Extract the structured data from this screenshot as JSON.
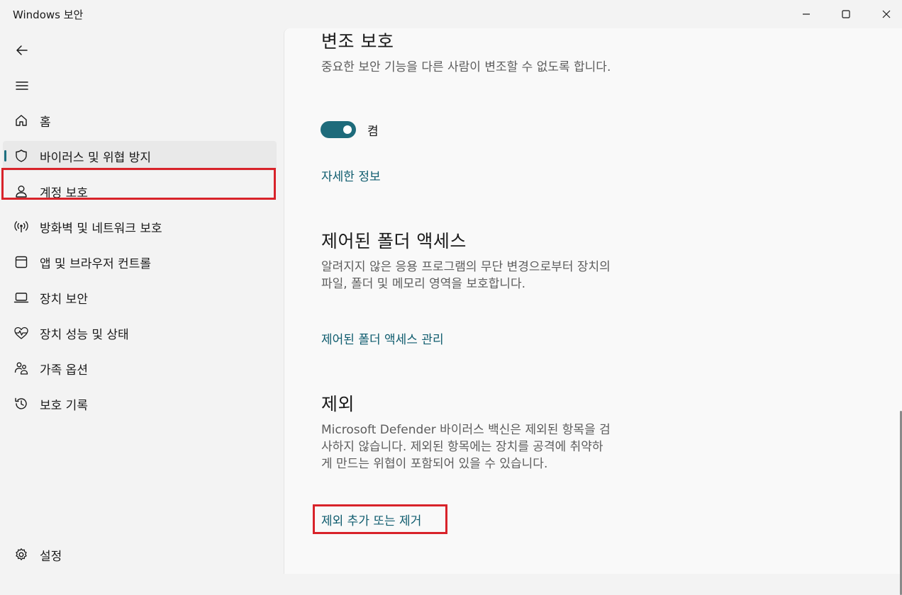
{
  "window": {
    "title": "Windows 보안"
  },
  "sidebar": {
    "items": [
      {
        "label": "홈",
        "icon": "home-icon"
      },
      {
        "label": "바이러스 및 위협 방지",
        "icon": "shield-icon"
      },
      {
        "label": "계정 보호",
        "icon": "person-icon"
      },
      {
        "label": "방화벽 및 네트워크 보호",
        "icon": "antenna-icon"
      },
      {
        "label": "앱 및 브라우저 컨트롤",
        "icon": "app-window-icon"
      },
      {
        "label": "장치 보안",
        "icon": "laptop-icon"
      },
      {
        "label": "장치 성능 및 상태",
        "icon": "heart-pulse-icon"
      },
      {
        "label": "가족 옵션",
        "icon": "family-icon"
      },
      {
        "label": "보호 기록",
        "icon": "history-icon"
      }
    ],
    "settings_label": "설정"
  },
  "content": {
    "tamper": {
      "title": "변조 보호",
      "desc": "중요한 보안 기능을 다른 사람이 변조할 수 없도록 합니다.",
      "toggle_state": "켬",
      "toggle_on": true,
      "link": "자세한 정보"
    },
    "cfa": {
      "title": "제어된 폴더 액세스",
      "desc": "알려지지 않은 응용 프로그램의 무단 변경으로부터 장치의 파일, 폴더 및 메모리 영역을 보호합니다.",
      "link": "제어된 폴더 액세스 관리"
    },
    "exclusions": {
      "title": "제외",
      "desc": "Microsoft Defender 바이러스 백신은 제외된 항목을 검사하지 않습니다. 제외된 항목에는 장치를 공격에 취약하게 만드는 위협이 포함되어 있을 수 있습니다.",
      "link": "제외 추가 또는 제거"
    }
  },
  "colors": {
    "accent": "#1e6b7b",
    "link": "#0f5c6e",
    "highlight": "#d8232a"
  }
}
